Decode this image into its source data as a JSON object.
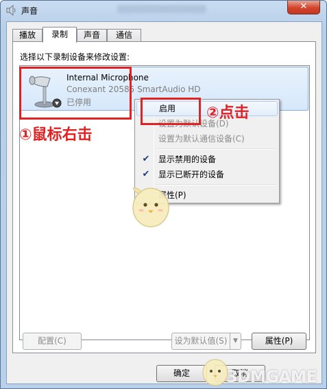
{
  "window": {
    "title": "声音",
    "close_label": "✕"
  },
  "tabs": [
    {
      "label": "播放",
      "active": false
    },
    {
      "label": "录制",
      "active": true
    },
    {
      "label": "声音",
      "active": false
    },
    {
      "label": "通信",
      "active": false
    }
  ],
  "instruction": "选择以下录制设备来修改设置:",
  "device": {
    "name": "Internal Microphone",
    "driver": "Conexant 20585 SmartAudio HD",
    "status": "已停用",
    "icon": "microphone-icon"
  },
  "context_menu": {
    "items": [
      {
        "label": "启用",
        "enabled": true,
        "checked": false,
        "highlighted": true
      },
      {
        "label": "设置为默认设备(D)",
        "enabled": false,
        "checked": false
      },
      {
        "label": "设置为默认通信设备(C)",
        "enabled": false,
        "checked": false
      },
      {
        "label": "显示禁用的设备",
        "enabled": true,
        "checked": true
      },
      {
        "label": "显示已断开的设备",
        "enabled": true,
        "checked": true
      },
      {
        "label": "属性(P)",
        "enabled": true,
        "checked": false
      }
    ]
  },
  "annotations": {
    "step1": "①鼠标右击",
    "step2": "②点击"
  },
  "buttons": {
    "configure": "配置(C)",
    "set_default": "设为默认值(S)",
    "properties": "属性(P)",
    "ok": "确定",
    "cancel": "取消"
  },
  "watermark": "3DMGAME",
  "colors": {
    "annotation_red": "#e22222",
    "selection_blue": "#84acdd",
    "check_blue": "#1c3c84"
  }
}
